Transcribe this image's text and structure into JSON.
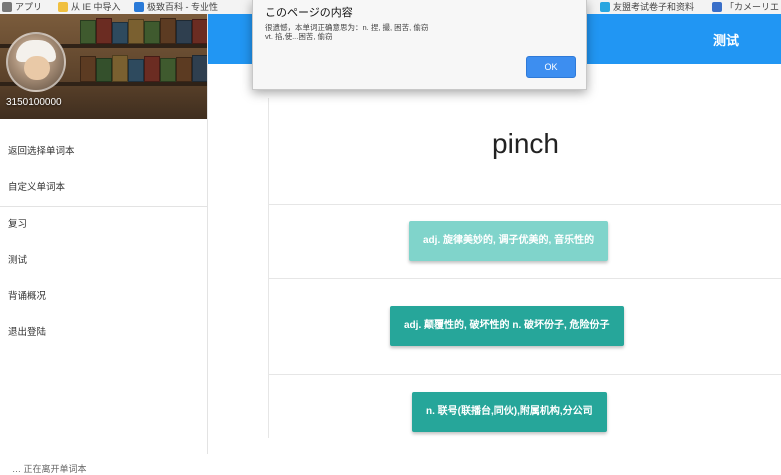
{
  "bookmarks": [
    {
      "label": "アプリ",
      "icon": "apps-grid-icon"
    },
    {
      "label": "从 IE 中导入",
      "icon": "folder-icon"
    },
    {
      "label": "极致百科 - 专业性",
      "icon": "bookmark-site-icon"
    },
    {
      "label": "友盟考试卷子和资料",
      "icon": "bookmark-site-icon"
    },
    {
      "label": "「カメーリエ",
      "icon": "bookmark-site-icon"
    }
  ],
  "appbar": {
    "title": "测试"
  },
  "sidebar": {
    "username": "3150100000",
    "items": [
      {
        "label": "返回选择单词本"
      },
      {
        "label": "自定义单词本"
      },
      {
        "label": "复习"
      },
      {
        "label": "测试"
      },
      {
        "label": "背诵概况"
      },
      {
        "label": "退出登陆"
      }
    ]
  },
  "quiz": {
    "word": "pinch",
    "options": [
      {
        "label": "adj. 旋律美妙的, 调子优美的, 音乐性的",
        "color": "#80d4cb"
      },
      {
        "label": "adj. 颠覆性的, 破坏性的 n. 破坏份子, 危险份子",
        "color": "#26a69a"
      },
      {
        "label": "n. 联号(联播台,同伙),附属机构,分公司",
        "color": "#26a69a"
      }
    ]
  },
  "dialog": {
    "title": "このページの内容",
    "message_line1": "很遗憾，本单词正确意思为：n. 捏, 撮, 困苦, 偷窃",
    "message_line2": "vt. 掐,使...困苦, 偷窃",
    "ok_label": "OK"
  },
  "footer": {
    "text": "… 正在离开单词本"
  },
  "colors": {
    "primary": "#2196f3",
    "teal": "#26a69a",
    "teal_light": "#80d4cb"
  }
}
